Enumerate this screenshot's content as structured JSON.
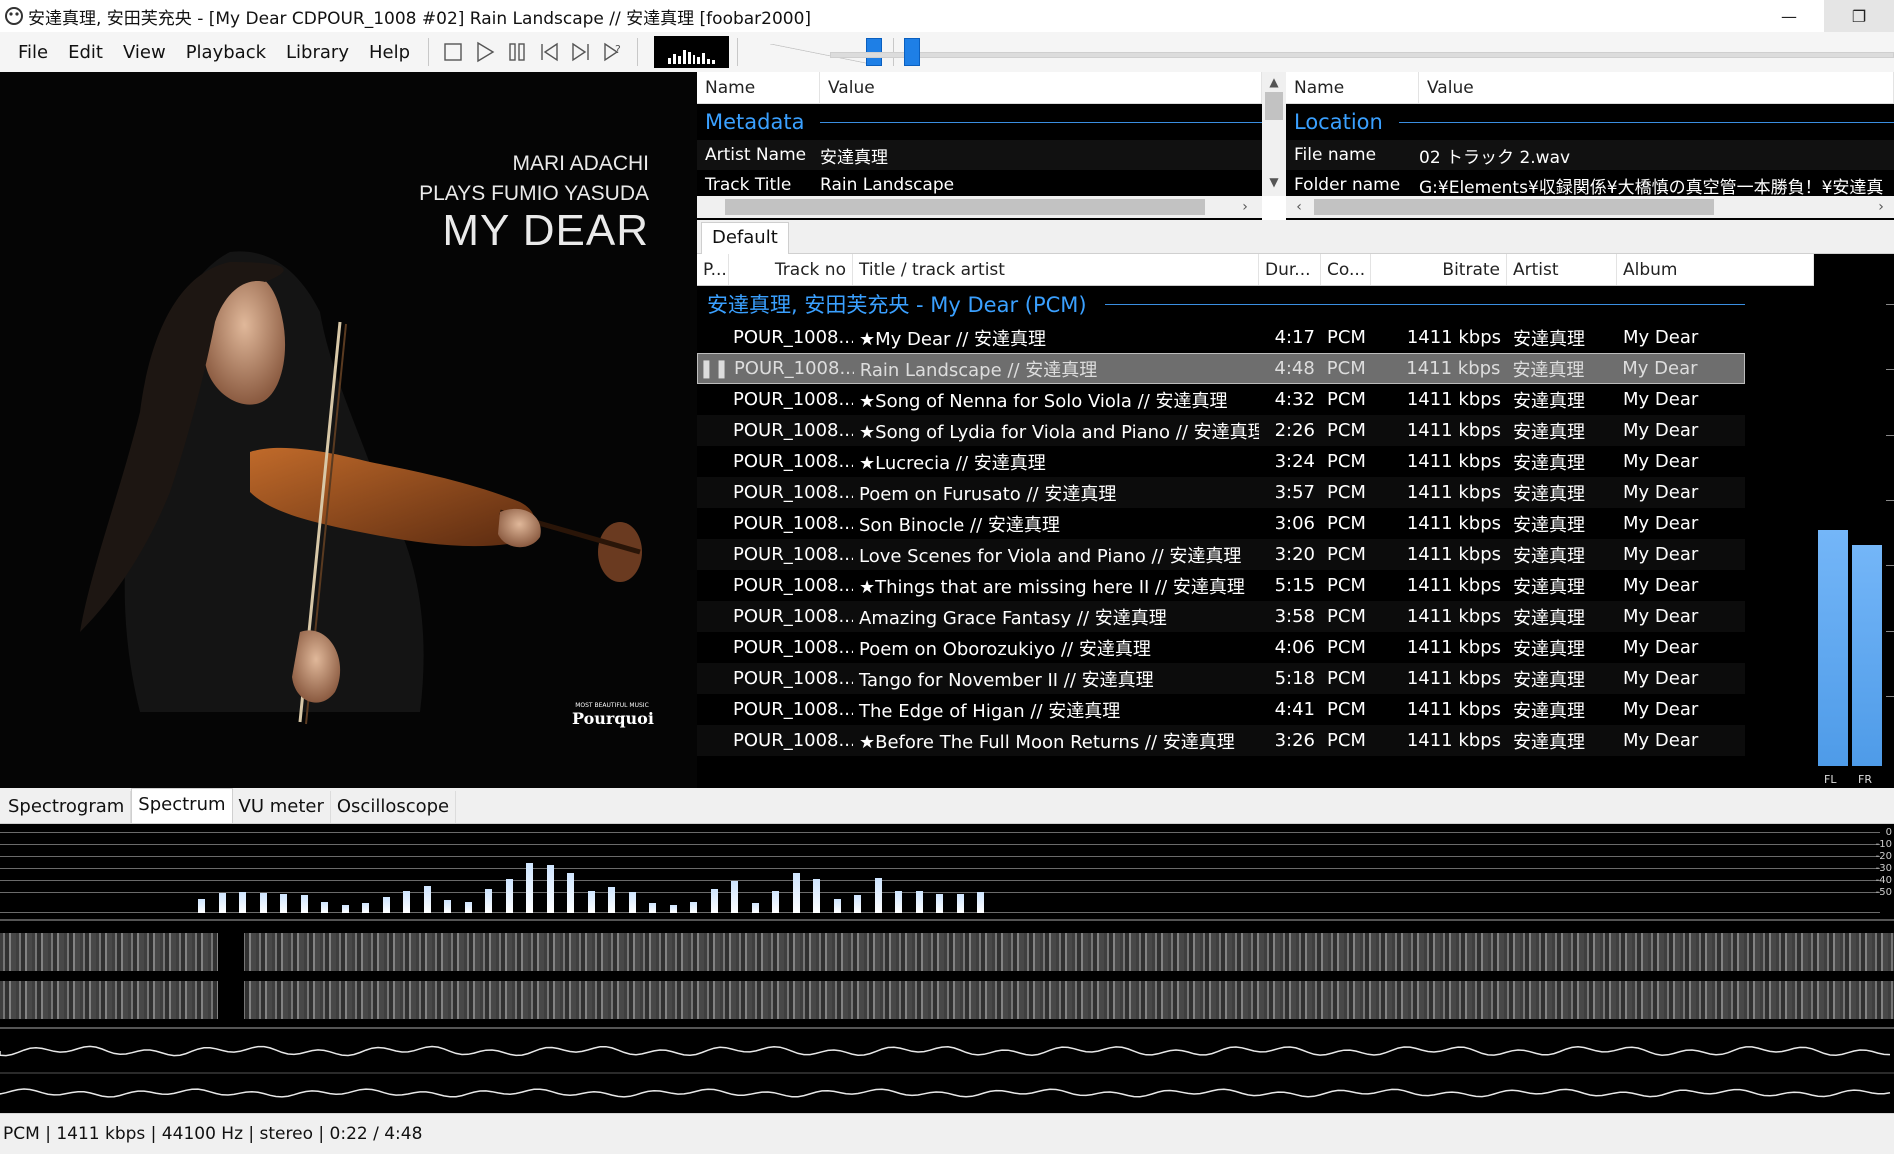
{
  "window": {
    "title": "安達真理, 安田芙充央 - [My Dear CDPOUR_1008 #02] Rain Landscape // 安達真理  [foobar2000]",
    "minimize_glyph": "—",
    "restore_glyph": "❐",
    "close_glyph": "✕"
  },
  "menu": [
    "File",
    "Edit",
    "View",
    "Playback",
    "Library",
    "Help"
  ],
  "album_art": {
    "line1": "MARI ADACHI",
    "line2": "PLAYS FUMIO YASUDA",
    "line3": "MY DEAR",
    "label_small": "MOST BEAUTIFUL MUSIC",
    "label_big": "Pourquoi"
  },
  "volume_fraction": 0.9,
  "seek_position": "0:22",
  "properties_left": {
    "col_name": "Name",
    "col_value": "Value",
    "group": "Metadata",
    "rows": [
      {
        "name": "Artist Name",
        "value": "安達真理"
      },
      {
        "name": "Track Title",
        "value": "Rain Landscape"
      }
    ]
  },
  "properties_right": {
    "col_name": "Name",
    "col_value": "Value",
    "group": "Location",
    "rows": [
      {
        "name": "File name",
        "value": "02 トラック 2.wav"
      },
      {
        "name": "Folder name",
        "value": "G:¥Elements¥収録関係¥大橋慎の真空管一本勝負！¥安達真"
      }
    ]
  },
  "playlist_tab": "Default",
  "playlist": {
    "columns": {
      "playing": "P...",
      "track_no": "Track no",
      "title": "Title / track artist",
      "duration": "Dur...",
      "codec": "Co...",
      "bitrate": "Bitrate",
      "artist": "Artist",
      "album": "Album"
    },
    "group_header": "安達真理, 安田芙充央 - My Dear (PCM)",
    "rows": [
      {
        "no": "POUR_1008....",
        "title": "★My Dear // 安達真理",
        "dur": "4:17",
        "codec": "PCM",
        "bitrate": "1411 kbps",
        "artist": "安達真理",
        "album": "My Dear",
        "playing": false
      },
      {
        "no": "POUR_1008....",
        "title": "Rain Landscape // 安達真理",
        "dur": "4:48",
        "codec": "PCM",
        "bitrate": "1411 kbps",
        "artist": "安達真理",
        "album": "My Dear",
        "playing": true
      },
      {
        "no": "POUR_1008....",
        "title": "★Song of Nenna for Solo Viola // 安達真理",
        "dur": "4:32",
        "codec": "PCM",
        "bitrate": "1411 kbps",
        "artist": "安達真理",
        "album": "My Dear",
        "playing": false
      },
      {
        "no": "POUR_1008....",
        "title": "★Song of Lydia for Viola and Piano // 安達真理",
        "dur": "2:26",
        "codec": "PCM",
        "bitrate": "1411 kbps",
        "artist": "安達真理",
        "album": "My Dear",
        "playing": false
      },
      {
        "no": "POUR_1008....",
        "title": "★Lucrecia // 安達真理",
        "dur": "3:24",
        "codec": "PCM",
        "bitrate": "1411 kbps",
        "artist": "安達真理",
        "album": "My Dear",
        "playing": false
      },
      {
        "no": "POUR_1008....",
        "title": "Poem on Furusato // 安達真理",
        "dur": "3:57",
        "codec": "PCM",
        "bitrate": "1411 kbps",
        "artist": "安達真理",
        "album": "My Dear",
        "playing": false
      },
      {
        "no": "POUR_1008....",
        "title": "Son Binocle // 安達真理",
        "dur": "3:06",
        "codec": "PCM",
        "bitrate": "1411 kbps",
        "artist": "安達真理",
        "album": "My Dear",
        "playing": false
      },
      {
        "no": "POUR_1008....",
        "title": "Love Scenes for Viola and Piano // 安達真理",
        "dur": "3:20",
        "codec": "PCM",
        "bitrate": "1411 kbps",
        "artist": "安達真理",
        "album": "My Dear",
        "playing": false
      },
      {
        "no": "POUR_1008....",
        "title": "★Things that are missing here II // 安達真理",
        "dur": "5:15",
        "codec": "PCM",
        "bitrate": "1411 kbps",
        "artist": "安達真理",
        "album": "My Dear",
        "playing": false
      },
      {
        "no": "POUR_1008....",
        "title": "Amazing Grace Fantasy // 安達真理",
        "dur": "3:58",
        "codec": "PCM",
        "bitrate": "1411 kbps",
        "artist": "安達真理",
        "album": "My Dear",
        "playing": false
      },
      {
        "no": "POUR_1008....",
        "title": "Poem on Oborozukiyo // 安達真理",
        "dur": "4:06",
        "codec": "PCM",
        "bitrate": "1411 kbps",
        "artist": "安達真理",
        "album": "My Dear",
        "playing": false
      },
      {
        "no": "POUR_1008....",
        "title": "Tango for November II // 安達真理",
        "dur": "5:18",
        "codec": "PCM",
        "bitrate": "1411 kbps",
        "artist": "安達真理",
        "album": "My Dear",
        "playing": false
      },
      {
        "no": "POUR_1008....",
        "title": "The Edge of Higan // 安達真理",
        "dur": "4:41",
        "codec": "PCM",
        "bitrate": "1411 kbps",
        "artist": "安達真理",
        "album": "My Dear",
        "playing": false
      },
      {
        "no": "POUR_1008....",
        "title": "★Before The Full Moon Returns // 安達真理",
        "dur": "3:26",
        "codec": "PCM",
        "bitrate": "1411 kbps",
        "artist": "安達真理",
        "album": "My Dear",
        "playing": false
      }
    ]
  },
  "peak_meter": {
    "channels": [
      {
        "label": "FL",
        "level": 0.47
      },
      {
        "label": "FR",
        "level": 0.44
      }
    ]
  },
  "vis_tabs": [
    "Spectrogram",
    "Spectrum",
    "VU meter",
    "Oscilloscope"
  ],
  "vis_active": "Spectrum",
  "spectrum": {
    "db_labels": [
      "0",
      "-10",
      "-20",
      "-30",
      "-40",
      "-50"
    ],
    "levels": [
      0.18,
      0.25,
      0.26,
      0.25,
      0.24,
      0.22,
      0.14,
      0.1,
      0.12,
      0.2,
      0.28,
      0.34,
      0.16,
      0.14,
      0.3,
      0.42,
      0.62,
      0.6,
      0.5,
      0.28,
      0.32,
      0.26,
      0.12,
      0.1,
      0.14,
      0.3,
      0.4,
      0.12,
      0.28,
      0.5,
      0.42,
      0.18,
      0.22,
      0.44,
      0.28,
      0.28,
      0.24,
      0.24,
      0.26
    ]
  },
  "status": "PCM | 1411 kbps | 44100 Hz | stereo | 0:22 / 4:48"
}
